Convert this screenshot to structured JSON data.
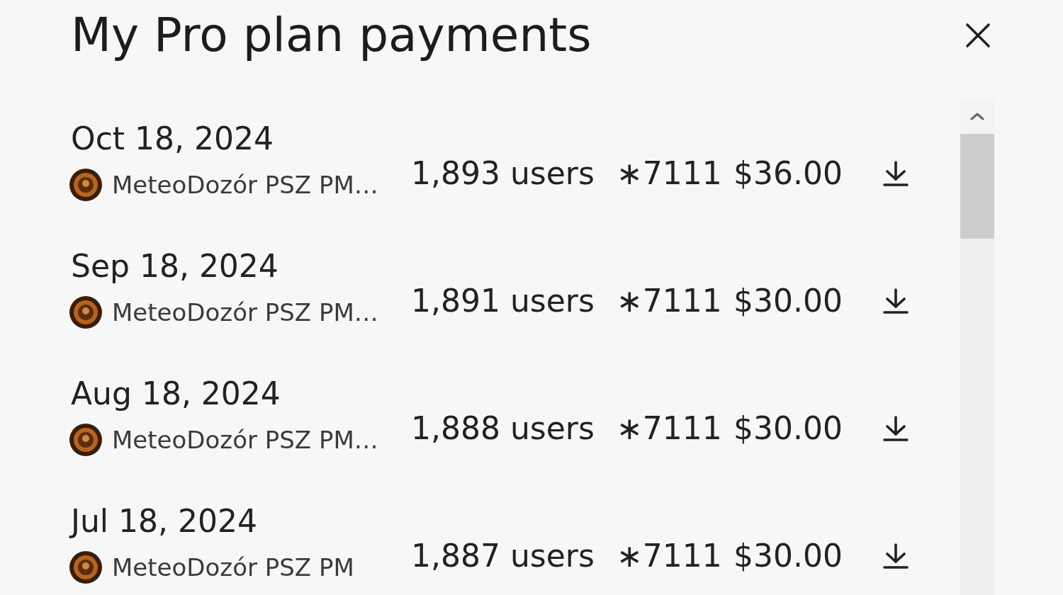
{
  "dialog": {
    "title": "My Pro plan payments"
  },
  "payments": [
    {
      "date": "Oct 18, 2024",
      "team": "MeteoDozór PSZ PM…",
      "users": "1,893 users",
      "card": "∗7111",
      "amount": "$36.00"
    },
    {
      "date": "Sep 18, 2024",
      "team": "MeteoDozór PSZ PM…",
      "users": "1,891 users",
      "card": "∗7111",
      "amount": "$30.00"
    },
    {
      "date": "Aug 18, 2024",
      "team": "MeteoDozór PSZ PM…",
      "users": "1,888 users",
      "card": "∗7111",
      "amount": "$30.00"
    },
    {
      "date": "Jul 18, 2024",
      "team": "MeteoDozór PSZ PM",
      "users": "1,887 users",
      "card": "∗7111",
      "amount": "$30.00"
    }
  ]
}
